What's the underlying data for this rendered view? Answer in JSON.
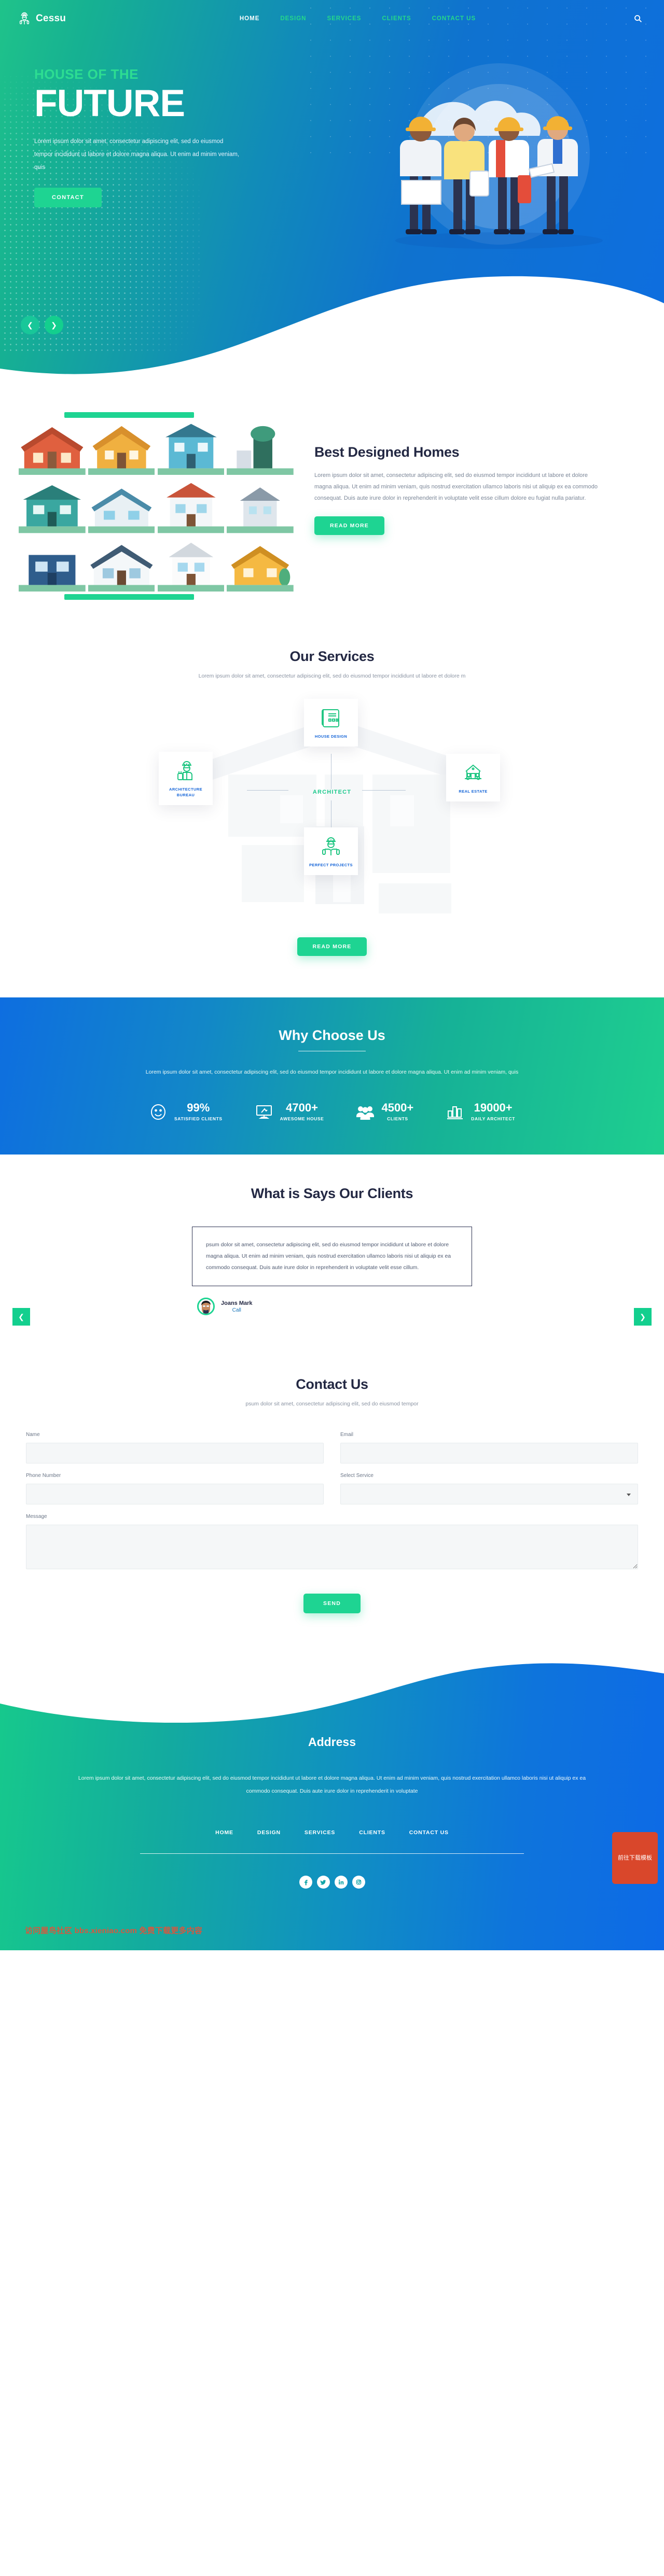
{
  "nav": {
    "brand": "Cessu",
    "brand_icon": "architect-helmet-icon",
    "links": [
      {
        "label": "HOME",
        "active": true
      },
      {
        "label": "DESIGN",
        "active": false
      },
      {
        "label": "SERVICES",
        "active": false
      },
      {
        "label": "CLIENTS",
        "active": false
      },
      {
        "label": "CONTACT US",
        "active": false
      }
    ],
    "search_icon": "search-icon"
  },
  "hero": {
    "eyebrow": "HOUSE OF THE",
    "title": "FUTURE",
    "subtitle": "Lorem ipsum dolor sit amet, consectetur adipiscing elit, sed do eiusmod tempor incididunt ut labore et dolore magna aliqua. Ut enim ad minim veniam, quis",
    "cta": "CONTACT",
    "prev_icon": "chevron-left-icon",
    "next_icon": "chevron-right-icon"
  },
  "homes": {
    "title": "Best Designed Homes",
    "body": "Lorem ipsum dolor sit amet, consectetur adipiscing elit, sed do eiusmod tempor incididunt ut labore et dolore magna aliqua. Ut enim ad minim veniam, quis nostrud exercitation ullamco laboris nisi ut aliquip ex ea commodo consequat. Duis aute irure dolor in reprehenderit in voluptate velit esse cillum dolore eu fugiat nulla pariatur.",
    "cta": "READ MORE"
  },
  "services": {
    "title": "Our Services",
    "subtitle": "Lorem ipsum dolor sit amet, consectetur adipiscing elit, sed do eiusmod tempor incididunt ut labore et dolore m",
    "center_label": "ARCHITECT",
    "cards": [
      {
        "label": "HOUSE DESIGN",
        "icon": "blueprint-icon"
      },
      {
        "label": "ARCHITECTURE BUREAU",
        "icon": "architect-worker-icon"
      },
      {
        "label": "REAL ESTATE",
        "icon": "house-keys-icon"
      },
      {
        "label": "PERFECT PROJECTS",
        "icon": "engineer-plans-icon"
      }
    ],
    "cta": "READ MORE"
  },
  "why": {
    "title": "Why Choose Us",
    "subtitle": "Lorem ipsum dolor sit amet, consectetur adipiscing elit, sed do eiusmod tempor incididunt ut labore et dolore magna aliqua. Ut enim ad minim veniam, quis",
    "stats": [
      {
        "value": "99%",
        "label": "SATISFIED CLIENTS",
        "icon": "smiley-face-icon"
      },
      {
        "value": "4700+",
        "label": "AWESOME HOUSE",
        "icon": "monitor-icon"
      },
      {
        "value": "4500+",
        "label": "CLIENTS",
        "icon": "people-group-icon"
      },
      {
        "value": "19000+",
        "label": "DAILY ARCHITECT",
        "icon": "bar-chart-icon"
      }
    ]
  },
  "testimonials": {
    "title": "What is Says Our Clients",
    "quote": "psum dolor sit amet, consectetur adipiscing elit, sed do eiusmod tempor incididunt ut labore et dolore magna aliqua. Ut enim ad minim veniam, quis nostrud exercitation ullamco laboris nisi ut aliquip ex ea commodo consequat. Duis aute irure dolor in reprehenderit in voluptate velit esse cillum.",
    "author_name": "Joans Mark",
    "author_role": "Call",
    "prev_icon": "chevron-left-icon",
    "next_icon": "chevron-right-icon"
  },
  "contact": {
    "title": "Contact Us",
    "subtitle": "psum dolor sit amet, consectetur adipiscing elit, sed do eiusmod tempor",
    "fields": {
      "name_label": "Name",
      "name_value": "",
      "email_label": "Email",
      "email_value": "",
      "phone_label": "Phone Number",
      "phone_value": "",
      "service_label": "Select Service",
      "service_value": "",
      "message_label": "Message",
      "message_value": ""
    },
    "submit": "SEND"
  },
  "footer": {
    "title": "Address",
    "address": "Lorem ipsum dolor sit amet, consectetur adipiscing elit, sed do eiusmod tempor incididunt ut labore et dolore magna aliqua. Ut enim ad minim veniam, quis nostrud exercitation ullamco laboris nisi ut aliquip ex ea commodo consequat. Duis aute irure dolor in reprehenderit in voluptate",
    "links": [
      {
        "label": "HOME"
      },
      {
        "label": "DESIGN"
      },
      {
        "label": "SERVICES"
      },
      {
        "label": "CLIENTS"
      },
      {
        "label": "CONTACT US"
      }
    ],
    "socials": [
      {
        "icon": "facebook-icon"
      },
      {
        "icon": "twitter-icon"
      },
      {
        "icon": "linkedin-icon"
      },
      {
        "icon": "instagram-icon"
      }
    ],
    "watermark": "访问屋鸟社区 bbs.xieniao.com 免费下载更多内容",
    "download_badge": "前往下载模板"
  },
  "colors": {
    "green": "#1ed492",
    "blue": "#0e6ee0",
    "dark": "#232843",
    "label_blue": "#1565d8"
  }
}
